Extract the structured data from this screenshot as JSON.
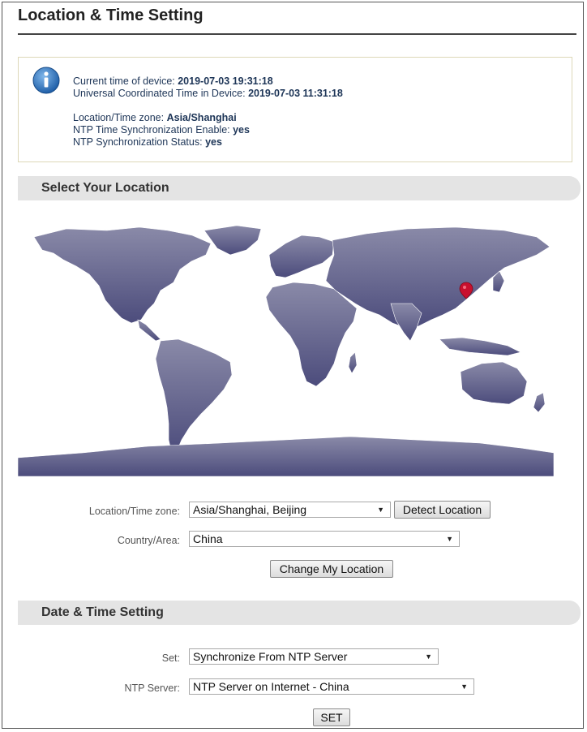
{
  "page": {
    "title": "Location & Time Setting"
  },
  "info": {
    "current_time_label": "Current time of device:",
    "current_time_value": "2019-07-03 19:31:18",
    "utc_label": "Universal Coordinated Time in Device:",
    "utc_value": "2019-07-03 11:31:18",
    "timezone_label": "Location/Time zone:",
    "timezone_value": "Asia/Shanghai",
    "ntp_enable_label": "NTP Time Synchronization Enable:",
    "ntp_enable_value": "yes",
    "ntp_status_label": "NTP Synchronization Status:",
    "ntp_status_value": "yes"
  },
  "location_section": {
    "title": "Select Your Location",
    "timezone_label": "Location/Time zone:",
    "timezone_selected": "Asia/Shanghai, Beijing",
    "detect_button": "Detect Location",
    "country_label": "Country/Area:",
    "country_selected": "China",
    "change_button": "Change My Location"
  },
  "datetime_section": {
    "title": "Date & Time Setting",
    "set_label": "Set:",
    "set_selected": "Synchronize From NTP Server",
    "ntp_label": "NTP Server:",
    "ntp_selected": "NTP Server on Internet - China",
    "set_button": "SET"
  },
  "colors": {
    "map_land": "#5b5b8a",
    "marker": "#c8102e",
    "info_icon": "#2f6fb5"
  },
  "icons": {
    "info": "info-icon",
    "marker": "map-marker-icon",
    "dropdown": "chevron-down-icon"
  }
}
